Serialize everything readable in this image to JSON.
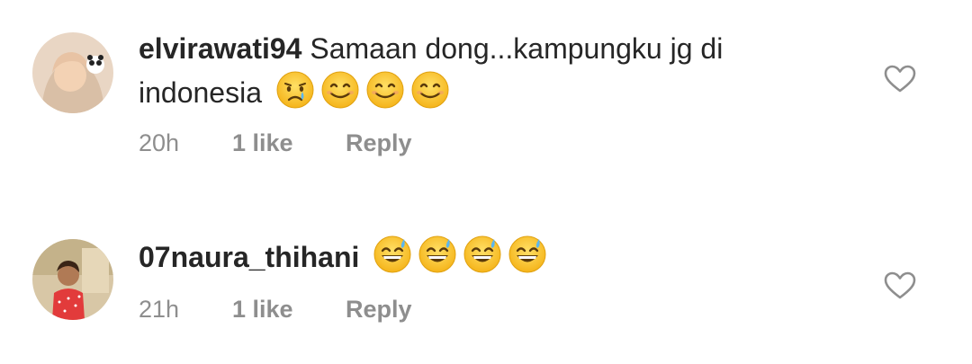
{
  "comments": [
    {
      "username": "elvirawati94",
      "text": "Samaan dong...kampungku jg di indonesia",
      "emojis": [
        "crying-face-emoji",
        "smiling-face-emoji",
        "smiling-face-emoji",
        "smiling-face-emoji"
      ],
      "time": "20h",
      "likes": "1 like",
      "reply": "Reply"
    },
    {
      "username": "07naura_thihani",
      "text": "",
      "emojis": [
        "grinning-sweat-emoji",
        "grinning-sweat-emoji",
        "grinning-sweat-emoji",
        "grinning-sweat-emoji"
      ],
      "time": "21h",
      "likes": "1 like",
      "reply": "Reply"
    }
  ],
  "colors": {
    "text": "#262626",
    "meta": "#8e8e8e",
    "background": "#ffffff",
    "emoji_yellow": "#f7c51e"
  }
}
